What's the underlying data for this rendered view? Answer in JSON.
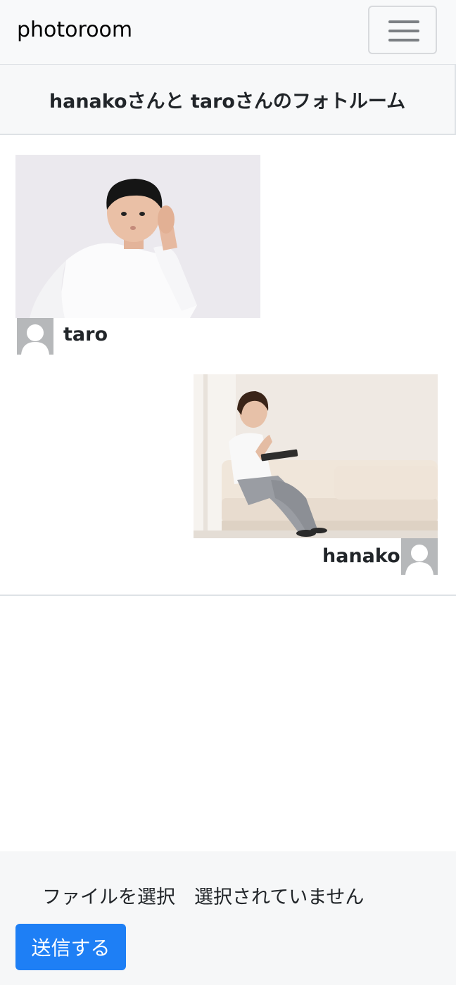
{
  "navbar": {
    "brand": "photoroom",
    "menu_icon": "hamburger-menu-icon"
  },
  "room": {
    "title": "hanakoさんと taroさんのフォトルーム"
  },
  "messages": [
    {
      "username": "taro",
      "side": "left",
      "photo": "boy-listening-photo",
      "avatar_icon": "default-user-icon"
    },
    {
      "username": "hanako",
      "side": "right",
      "photo": "woman-on-sofa-photo",
      "avatar_icon": "default-user-icon"
    }
  ],
  "form": {
    "file_button_label": "ファイルを選択",
    "file_status": "選択されていません",
    "submit_label": "送信する"
  },
  "colors": {
    "primary": "#1e7ff5",
    "navbar_bg": "#f8f9fa",
    "avatar_bg": "#b6b8ba"
  }
}
